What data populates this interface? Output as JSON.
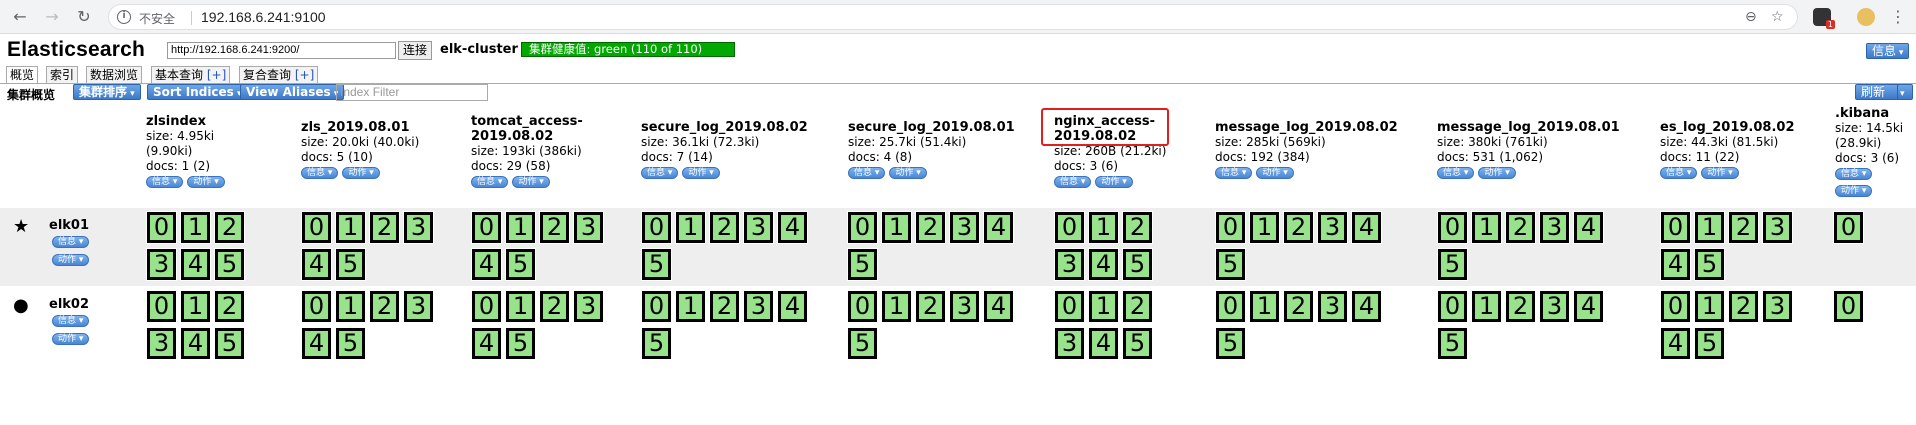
{
  "browser": {
    "security_text": "不安全",
    "url": "192.168.6.241:9100",
    "extension_badge": "1"
  },
  "app": {
    "title": "Elasticsearch",
    "connect_url": "http://192.168.6.241:9200/",
    "connect_button": "连接",
    "cluster_name": "elk-cluster",
    "health": "集群健康值: green (110 of 110)",
    "health_color": "#00a800",
    "info_menu": "信息",
    "refresh_button": "刷新"
  },
  "tabs": [
    {
      "label": "概览",
      "plus": ""
    },
    {
      "label": "索引",
      "plus": ""
    },
    {
      "label": "数据浏览",
      "plus": ""
    },
    {
      "label": "基本查询",
      "plus": "[+]"
    },
    {
      "label": "复合查询",
      "plus": "[+]"
    }
  ],
  "toolbar": {
    "overview_label": "集群概览",
    "sort_cluster": "集群排序",
    "sort_indices": "Sort Indices",
    "view_aliases": "View Aliases",
    "index_filter_placeholder": "Index Filter"
  },
  "actions": {
    "info": "信息",
    "action": "动作"
  },
  "indices": [
    {
      "name_lines": [
        "zlsindex"
      ],
      "size": "size: 4.95ki",
      "size2": "(9.90ki)",
      "docs": "docs: 1 (2)",
      "shards_row1": [
        "0",
        "1",
        "2",
        "3",
        "4",
        "5"
      ],
      "shards_row2": [
        "0",
        "1",
        "2",
        "3",
        "4",
        "5"
      ]
    },
    {
      "name_lines": [
        "zls_2019.08.01"
      ],
      "size": "size: 20.0ki (40.0ki)",
      "size2": "",
      "docs": "docs: 5 (10)",
      "shards_row1": [
        "0",
        "1",
        "2",
        "3",
        "4",
        "5"
      ],
      "shards_row2": [
        "0",
        "1",
        "2",
        "3",
        "4",
        "5"
      ]
    },
    {
      "name_lines": [
        "tomcat_access-",
        "2019.08.02"
      ],
      "size": "size: 193ki (386ki)",
      "size2": "",
      "docs": "docs: 29 (58)",
      "shards_row1": [
        "0",
        "1",
        "2",
        "3",
        "4",
        "5"
      ],
      "shards_row2": [
        "0",
        "1",
        "2",
        "3",
        "4",
        "5"
      ]
    },
    {
      "name_lines": [
        "secure_log_2019.08.02"
      ],
      "size": "size: 36.1ki (72.3ki)",
      "size2": "",
      "docs": "docs: 7 (14)",
      "shards_row1": [
        "0",
        "1",
        "2",
        "3",
        "4",
        "5"
      ],
      "shards_row2": [
        "0",
        "1",
        "2",
        "3",
        "4",
        "5"
      ]
    },
    {
      "name_lines": [
        "secure_log_2019.08.01"
      ],
      "size": "size: 25.7ki (51.4ki)",
      "size2": "",
      "docs": "docs: 4 (8)",
      "shards_row1": [
        "0",
        "1",
        "2",
        "3",
        "4",
        "5"
      ],
      "shards_row2": [
        "0",
        "1",
        "2",
        "3",
        "4",
        "5"
      ]
    },
    {
      "name_lines": [
        "nginx_access-",
        "2019.08.02"
      ],
      "size": "size: 260B (21.2ki)",
      "size2": "",
      "docs": "docs: 3 (6)",
      "shards_row1": [
        "0",
        "1",
        "2",
        "3",
        "4",
        "5"
      ],
      "shards_row2": [
        "0",
        "1",
        "2",
        "3",
        "4",
        "5"
      ]
    },
    {
      "name_lines": [
        "message_log_2019.08.02"
      ],
      "size": "size: 285ki (569ki)",
      "size2": "",
      "docs": "docs: 192 (384)",
      "shards_row1": [
        "0",
        "1",
        "2",
        "3",
        "4",
        "5"
      ],
      "shards_row2": [
        "0",
        "1",
        "2",
        "3",
        "4",
        "5"
      ]
    },
    {
      "name_lines": [
        "message_log_2019.08.01"
      ],
      "size": "size: 380ki (761ki)",
      "size2": "",
      "docs": "docs: 531 (1,062)",
      "shards_row1": [
        "0",
        "1",
        "2",
        "3",
        "4",
        "5"
      ],
      "shards_row2": [
        "0",
        "1",
        "2",
        "3",
        "4",
        "5"
      ]
    },
    {
      "name_lines": [
        "es_log_2019.08.02"
      ],
      "size": "size: 44.3ki (81.5ki)",
      "size2": "",
      "docs": "docs: 11 (22)",
      "shards_row1": [
        "0",
        "1",
        "2",
        "3",
        "4",
        "5"
      ],
      "shards_row2": [
        "0",
        "1",
        "2",
        "3",
        "4",
        "5"
      ]
    },
    {
      "name_lines": [
        ".kibana"
      ],
      "size": "size: 14.5ki",
      "size2": "(28.9ki)",
      "docs": "docs: 3 (6)",
      "shards_row1": [
        "0"
      ],
      "shards_row2": [
        "0"
      ]
    }
  ],
  "nodes": [
    {
      "name": "elk01",
      "icon": "★",
      "master": true
    },
    {
      "name": "elk02",
      "icon": "●",
      "master": false
    }
  ],
  "colors": {
    "shard_fill": "#99e28c",
    "highlight_border": "#e0201c",
    "row_alt": "#eeeeee"
  }
}
